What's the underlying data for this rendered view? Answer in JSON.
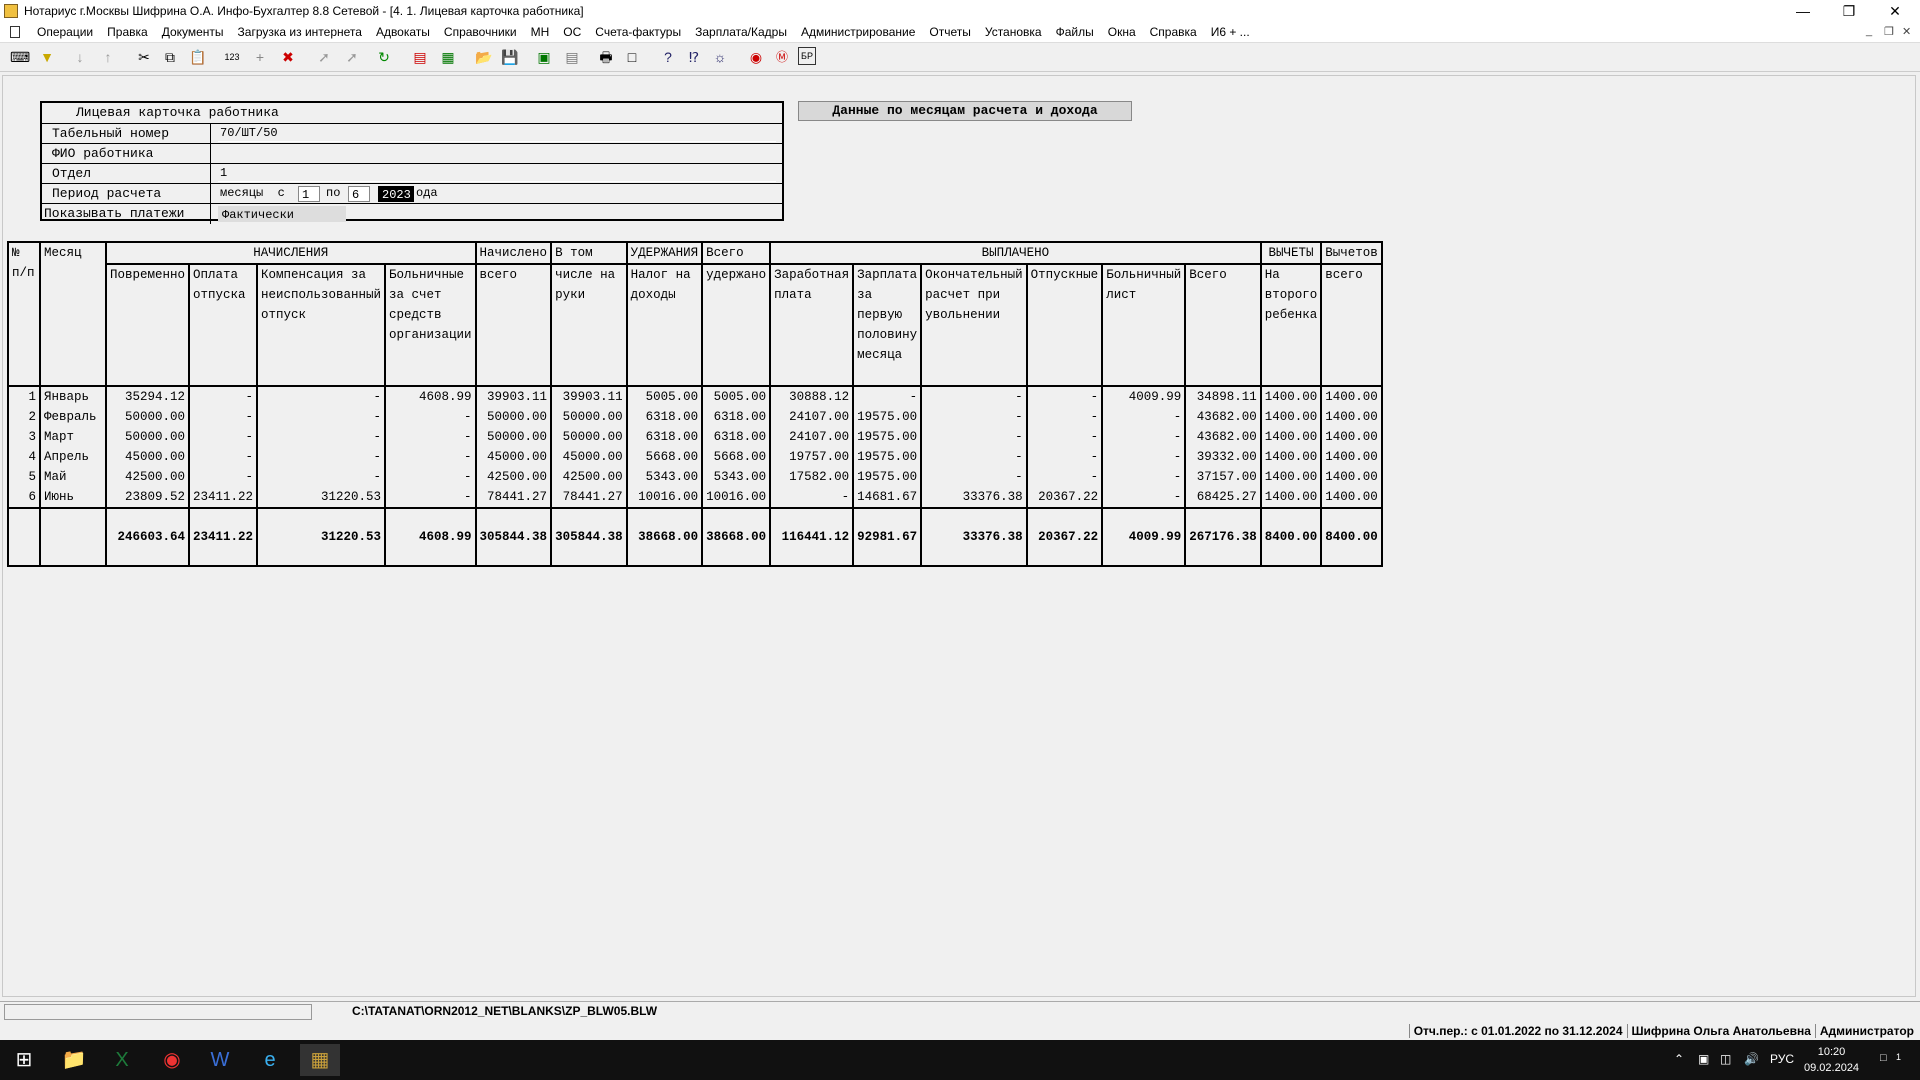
{
  "window": {
    "title": "Нотариус г.Москвы Шифрина О.А. Инфо-Бухгалтер 8.8 Сетевой - [4. 1. Лицевая карточка работника]"
  },
  "menu": [
    "Операции",
    "Правка",
    "Документы",
    "Загрузка из интернета",
    "Адвокаты",
    "Справочники",
    "МН",
    "ОС",
    "Счета-фактуры",
    "Зарплата/Кадры",
    "Администрирование",
    "Отчеты",
    "Установка",
    "Файлы",
    "Окна",
    "Справка",
    "И6 + ..."
  ],
  "card": {
    "header": "Лицевая карточка работника",
    "tab_label": "Табельный номер",
    "tab_value": "70/ШТ/50",
    "fio_label": "ФИО работника",
    "fio_value": "",
    "dept_label": "Отдел",
    "dept_value": "1",
    "period_label": "Период расчета",
    "period_months": "месяцы  с",
    "period_from": "1",
    "period_to_label": "по",
    "period_to": "6",
    "period_year": "2023",
    "period_year_suffix": "ода",
    "payments_label": "Показывать платежи",
    "payments_value": "Фактически"
  },
  "months_button": "Данные по месяцам расчета и дохода",
  "table": {
    "group_headers": {
      "num": "№ п/п",
      "month": "Месяц",
      "accruals": "НАЧИСЛЕНИЯ",
      "accrued": "Начислено",
      "net": "В том",
      "withholdings": "УДЕРЖАНИЯ",
      "total_withheld": "Всего",
      "paid": "ВЫПЛАЧЕНО",
      "deductions": "ВЫЧЕТЫ",
      "deductions_total": "Вычетов"
    },
    "sub_headers": [
      "Повременно",
      "Оплата отпуска",
      "Компенсация за неиспользованный отпуск",
      "Больничные за счет средств организации",
      "всего",
      "числе на руки",
      "Налог на доходы",
      "удержано",
      "Заработная плата",
      "Зарплата за первую половину месяца",
      "Окончательный расчет при увольнении",
      "Отпускные",
      "Больничный лист",
      "Всего",
      "На второго ребенка",
      "всего"
    ],
    "rows": [
      [
        "1",
        "Январь",
        "35294.12",
        "-",
        "-",
        "4608.99",
        "39903.11",
        "39903.11",
        "5005.00",
        "5005.00",
        "30888.12",
        "-",
        "-",
        "-",
        "4009.99",
        "34898.11",
        "1400.00",
        "1400.00"
      ],
      [
        "2",
        "Февраль",
        "50000.00",
        "-",
        "-",
        "-",
        "50000.00",
        "50000.00",
        "6318.00",
        "6318.00",
        "24107.00",
        "19575.00",
        "-",
        "-",
        "-",
        "43682.00",
        "1400.00",
        "1400.00"
      ],
      [
        "3",
        "Март",
        "50000.00",
        "-",
        "-",
        "-",
        "50000.00",
        "50000.00",
        "6318.00",
        "6318.00",
        "24107.00",
        "19575.00",
        "-",
        "-",
        "-",
        "43682.00",
        "1400.00",
        "1400.00"
      ],
      [
        "4",
        "Апрель",
        "45000.00",
        "-",
        "-",
        "-",
        "45000.00",
        "45000.00",
        "5668.00",
        "5668.00",
        "19757.00",
        "19575.00",
        "-",
        "-",
        "-",
        "39332.00",
        "1400.00",
        "1400.00"
      ],
      [
        "5",
        "Май",
        "42500.00",
        "-",
        "-",
        "-",
        "42500.00",
        "42500.00",
        "5343.00",
        "5343.00",
        "17582.00",
        "19575.00",
        "-",
        "-",
        "-",
        "37157.00",
        "1400.00",
        "1400.00"
      ],
      [
        "6",
        "Июнь",
        "23809.52",
        "23411.22",
        "31220.53",
        "-",
        "78441.27",
        "78441.27",
        "10016.00",
        "10016.00",
        "-",
        "14681.67",
        "33376.38",
        "20367.22",
        "-",
        "68425.27",
        "1400.00",
        "1400.00"
      ]
    ],
    "totals": [
      "",
      "",
      "246603.64",
      "23411.22",
      "31220.53",
      "4608.99",
      "305844.38",
      "305844.38",
      "38668.00",
      "38668.00",
      "116441.12",
      "92981.67",
      "33376.38",
      "20367.22",
      "4009.99",
      "267176.38",
      "8400.00",
      "8400.00"
    ]
  },
  "status": {
    "path": "C:\\TATANAT\\ORN2012_NET\\BLANKS\\ZP_BLW05.BLW",
    "period": "Отч.пер.: с 01.01.2022 по 31.12.2024",
    "user": "Шифрина Ольга Анатольевна",
    "role": "Администратор"
  },
  "taskbar": {
    "lang": "РУС",
    "time": "10:20",
    "date": "09.02.2024",
    "notifications": "1"
  }
}
